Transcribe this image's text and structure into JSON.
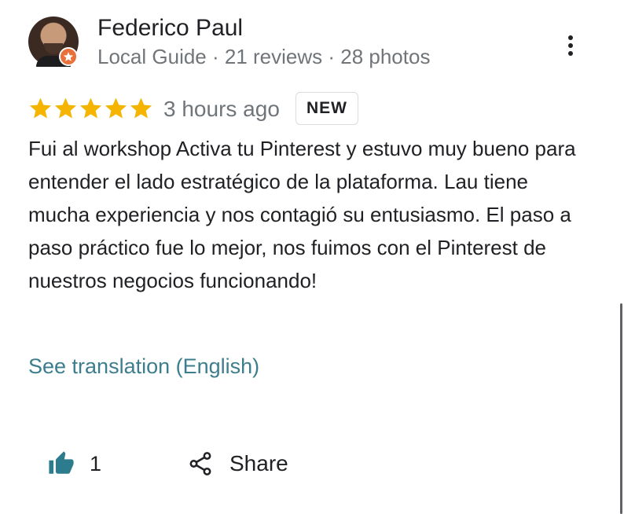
{
  "reviewer": {
    "name": "Federico Paul",
    "subline": "Local Guide · 21 reviews · 28 photos"
  },
  "review": {
    "rating": 5,
    "max_rating": 5,
    "time": "3 hours ago",
    "tag": "NEW",
    "text": "Fui al workshop Activa tu Pinterest y estuvo muy bueno para entender el lado estratégico de la plataforma. Lau tiene mucha experiencia y nos contagió su entusiasmo. El paso a paso práctico fue lo mejor, nos fuimos con el Pinterest de nuestros negocios funcionando!",
    "translation_link": "See translation (English)"
  },
  "actions": {
    "like_count": "1",
    "share_label": "Share"
  },
  "icons": {
    "more": "more-vert-icon",
    "star": "star-icon",
    "like": "thumbs-up-icon",
    "share": "share-icon",
    "guide_badge": "local-guide-badge-icon"
  },
  "colors": {
    "star": "#f4b400",
    "link": "#3c7d8e",
    "like_icon": "#2d7c8d",
    "badge": "#e8703a"
  }
}
